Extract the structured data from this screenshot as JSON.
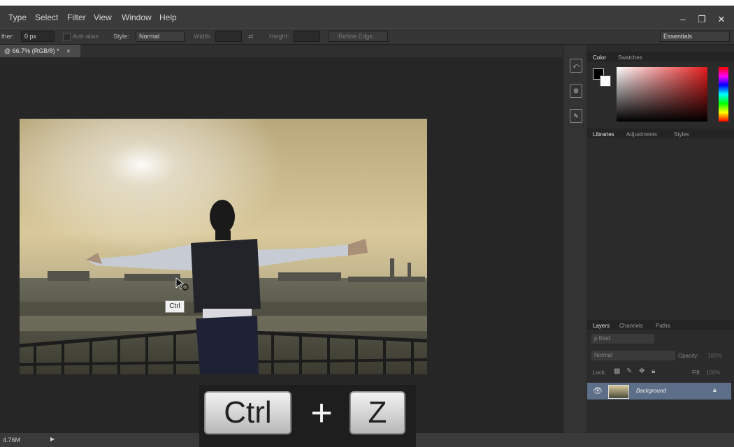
{
  "menu": {
    "items": [
      "Type",
      "Select",
      "Filter",
      "View",
      "Window",
      "Help"
    ]
  },
  "window_controls": {
    "minimize": "–",
    "restore": "❐",
    "close": "✕"
  },
  "options_bar": {
    "feather_label": "ther:",
    "feather_value": "0 px",
    "antialias_label": "Anti-alias",
    "style_label": "Style:",
    "style_value": "Normal",
    "width_label": "Width:",
    "height_label": "Height:",
    "refine_button": "Refine Edge...",
    "workspace": "Essentials"
  },
  "document": {
    "tab_label": "@ 66.7% (RGB/8) *",
    "tab_close": "×",
    "ctrl_tooltip": "Ctrl"
  },
  "panels": {
    "color_tabs": [
      "Color",
      "Swatches"
    ],
    "library_tabs": [
      "Libraries",
      "Adjustments",
      "Styles"
    ],
    "layers_tabs": [
      "Layers",
      "Channels",
      "Paths"
    ],
    "kind_filter": "ρ Kind",
    "blend_mode": "Normal",
    "opacity_label": "Opacity:",
    "opacity_value": "100%",
    "lock_label": "Lock:",
    "fill_label": "Fill:",
    "fill_value": "100%",
    "layer_name": "Background"
  },
  "status": {
    "doc_size": "4.76M",
    "arrow": "▶"
  },
  "overlay": {
    "key1": "Ctrl",
    "plus": "+",
    "key2": "Z"
  },
  "colors": {
    "menubar": "#3b3b3b",
    "panel_bg": "#2b2b2b",
    "canvas_bg": "#262626",
    "selected_layer": "#5d6e88"
  }
}
